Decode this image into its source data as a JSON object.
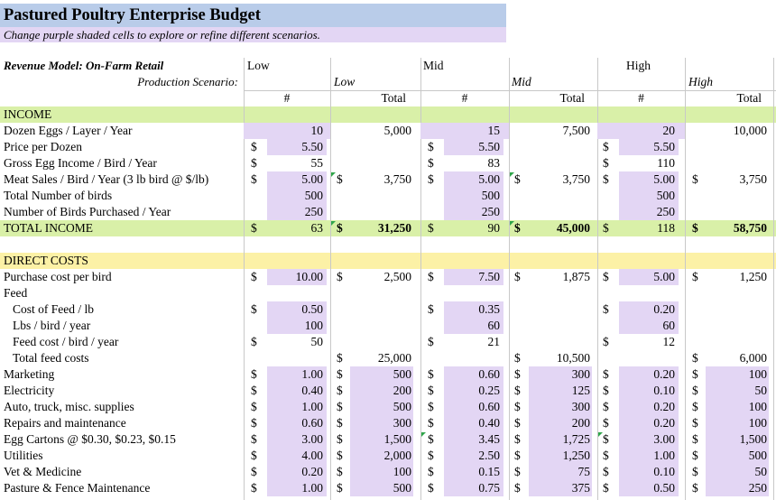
{
  "sheet": {
    "title": "Pastured Poultry Enterprise Budget",
    "subtitle": "Change purple shaded cells to explore or refine different scenarios.",
    "revenue_model_label": "Revenue Model: On-Farm Retail",
    "scenario_label": "Production Scenario:",
    "scenarios": {
      "low": {
        "name": "Low",
        "sub": "Low"
      },
      "mid": {
        "name": "Mid",
        "sub": "Mid"
      },
      "high": {
        "name": "High",
        "sub": "High"
      }
    },
    "col_hash": "#",
    "col_total": "Total",
    "currency": "$",
    "section_income": "INCOME",
    "section_direct": "DIRECT COSTS",
    "colors": {
      "purple": "#e3d6f4",
      "green": "#d9f0a8",
      "yellow": "#fcf1a6",
      "title_blue": "#b9cce9"
    },
    "rows": [
      {
        "label": "Dozen Eggs / Layer / Year",
        "cells": [
          "",
          "10",
          "",
          "5,000",
          "",
          "15",
          "",
          "7,500",
          "",
          "20",
          "",
          "10,000"
        ]
      },
      {
        "label": "Price per Dozen",
        "cells": [
          "$",
          "5.50",
          "",
          "",
          "$",
          "5.50",
          "",
          "",
          "$",
          "5.50",
          "",
          ""
        ]
      },
      {
        "label": "Gross Egg Income / Bird / Year",
        "cells": [
          "$",
          "55",
          "",
          "",
          "$",
          "83",
          "",
          "",
          "$",
          "110",
          "",
          ""
        ]
      },
      {
        "label": "Meat Sales / Bird / Year (3 lb bird @ $/lb)",
        "cells": [
          "$",
          "5.00",
          "$",
          "3,750",
          "$",
          "5.00",
          "$",
          "3,750",
          "$",
          "5.00",
          "$",
          "3,750"
        ]
      },
      {
        "label": "Total Number of birds",
        "cells": [
          "",
          "500",
          "",
          "",
          "",
          "500",
          "",
          "",
          "",
          "500",
          "",
          ""
        ]
      },
      {
        "label": "Number of Birds Purchased / Year",
        "cells": [
          "",
          "250",
          "",
          "",
          "",
          "250",
          "",
          "",
          "",
          "250",
          "",
          ""
        ]
      },
      {
        "label": "TOTAL INCOME",
        "cells": [
          "$",
          "63",
          "$",
          "31,250",
          "$",
          "90",
          "$",
          "45,000",
          "$",
          "118",
          "$",
          "58,750"
        ]
      },
      {
        "label": "",
        "cells": []
      },
      {
        "label": "DIRECT COSTS",
        "cells": []
      },
      {
        "label": "Purchase cost per bird",
        "cells": [
          "$",
          "10.00",
          "$",
          "2,500",
          "$",
          "7.50",
          "$",
          "1,875",
          "$",
          "5.00",
          "$",
          "1,250"
        ]
      },
      {
        "label": "Feed",
        "cells": []
      },
      {
        "label": "Cost of Feed / lb",
        "cells": [
          "$",
          "0.50",
          "",
          "",
          "$",
          "0.35",
          "",
          "",
          "$",
          "0.20",
          "",
          ""
        ]
      },
      {
        "label": "Lbs / bird / year",
        "cells": [
          "",
          "100",
          "",
          "",
          "",
          "60",
          "",
          "",
          "",
          "60",
          "",
          ""
        ]
      },
      {
        "label": "Feed cost / bird / year",
        "cells": [
          "$",
          "50",
          "",
          "",
          "$",
          "21",
          "",
          "",
          "$",
          "12",
          "",
          ""
        ]
      },
      {
        "label": "Total feed costs",
        "cells": [
          "",
          "",
          "$",
          "25,000",
          "",
          "",
          "$",
          "10,500",
          "",
          "",
          "$",
          "6,000"
        ]
      },
      {
        "label": "Marketing",
        "cells": [
          "$",
          "1.00",
          "$",
          "500",
          "$",
          "0.60",
          "$",
          "300",
          "$",
          "0.20",
          "$",
          "100"
        ]
      },
      {
        "label": "Electricity",
        "cells": [
          "$",
          "0.40",
          "$",
          "200",
          "$",
          "0.25",
          "$",
          "125",
          "$",
          "0.10",
          "$",
          "50"
        ]
      },
      {
        "label": "Auto, truck, misc. supplies",
        "cells": [
          "$",
          "1.00",
          "$",
          "500",
          "$",
          "0.60",
          "$",
          "300",
          "$",
          "0.20",
          "$",
          "100"
        ]
      },
      {
        "label": "Repairs and maintenance",
        "cells": [
          "$",
          "0.60",
          "$",
          "300",
          "$",
          "0.40",
          "$",
          "200",
          "$",
          "0.20",
          "$",
          "100"
        ]
      },
      {
        "label": "Egg Cartons @ $0.30, $0.23, $0.15",
        "cells": [
          "$",
          "3.00",
          "$",
          "1,500",
          "$",
          "3.45",
          "$",
          "1,725",
          "$",
          "3.00",
          "$",
          "1,500"
        ]
      },
      {
        "label": "Utilities",
        "cells": [
          "$",
          "4.00",
          "$",
          "2,000",
          "$",
          "2.50",
          "$",
          "1,250",
          "$",
          "1.00",
          "$",
          "500"
        ]
      },
      {
        "label": "Vet & Medicine",
        "cells": [
          "$",
          "0.20",
          "$",
          "100",
          "$",
          "0.15",
          "$",
          "75",
          "$",
          "0.10",
          "$",
          "50"
        ]
      },
      {
        "label": "Pasture & Fence Maintenance",
        "cells": [
          "$",
          "1.00",
          "$",
          "500",
          "$",
          "0.75",
          "$",
          "375",
          "$",
          "0.50",
          "$",
          "250"
        ]
      }
    ]
  }
}
